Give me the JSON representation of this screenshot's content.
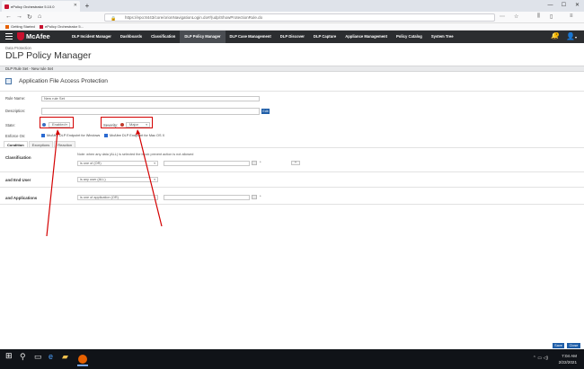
{
  "browser": {
    "tab_title": "ePolicy Orchestrator 5.10.0",
    "url": "https://epo:8443/core/orionNavigationLogin.do#/(udp/ShowProtectionRule.do",
    "bookmarks": [
      "Getting Started",
      "ePolicy Orchestrator 5..."
    ]
  },
  "app": {
    "brand": "McAfee",
    "menu": [
      "DLP Incident Manager",
      "Dashboards",
      "Classification",
      "DLP Policy Manager",
      "DLP Case Management",
      "DLP Discover",
      "DLP Capture",
      "Appliance Management",
      "Policy Catalog",
      "System Tree"
    ],
    "active_menu": "DLP Policy Manager",
    "notification_count": "1"
  },
  "page": {
    "breadcrumb": "Data Protection",
    "title": "DLP Policy Manager",
    "subbar": "DLP Rule Set - New rule Set"
  },
  "rule": {
    "header": "Application File Access Protection",
    "rule_name_label": "Rule Name:",
    "rule_name_value": "New rule Set",
    "description_label": "Description:",
    "edit_label": "Edit",
    "state_label": "State:",
    "state_value": "Enabled",
    "severity_label": "Severity:",
    "severity_value": "Major",
    "enforce_label": "Enforce On:",
    "enforce_options": [
      "McAfee DLP Endpoint for Windows",
      "McAfee DLP Endpoint for Mac OS X"
    ]
  },
  "tabs": [
    "Condition",
    "Exceptions",
    "Reaction"
  ],
  "condition": {
    "note": "Note: when any data (ALL) is selected the block prevent action is not allowed",
    "rows": [
      {
        "label": "Classification",
        "operator": "is one of (OR)"
      },
      {
        "label": "and End User",
        "operator": "is any user (ALL)"
      },
      {
        "label": "and Applications",
        "operator": "is one of application (OR)"
      }
    ]
  },
  "footer": {
    "save": "Save",
    "close": "Close"
  },
  "taskbar": {
    "time": "7:04 AM",
    "date": "2/22/2021"
  },
  "colors": {
    "accent": "#1f5ea8",
    "header": "#2b2d30",
    "annotation": "#d40000"
  }
}
